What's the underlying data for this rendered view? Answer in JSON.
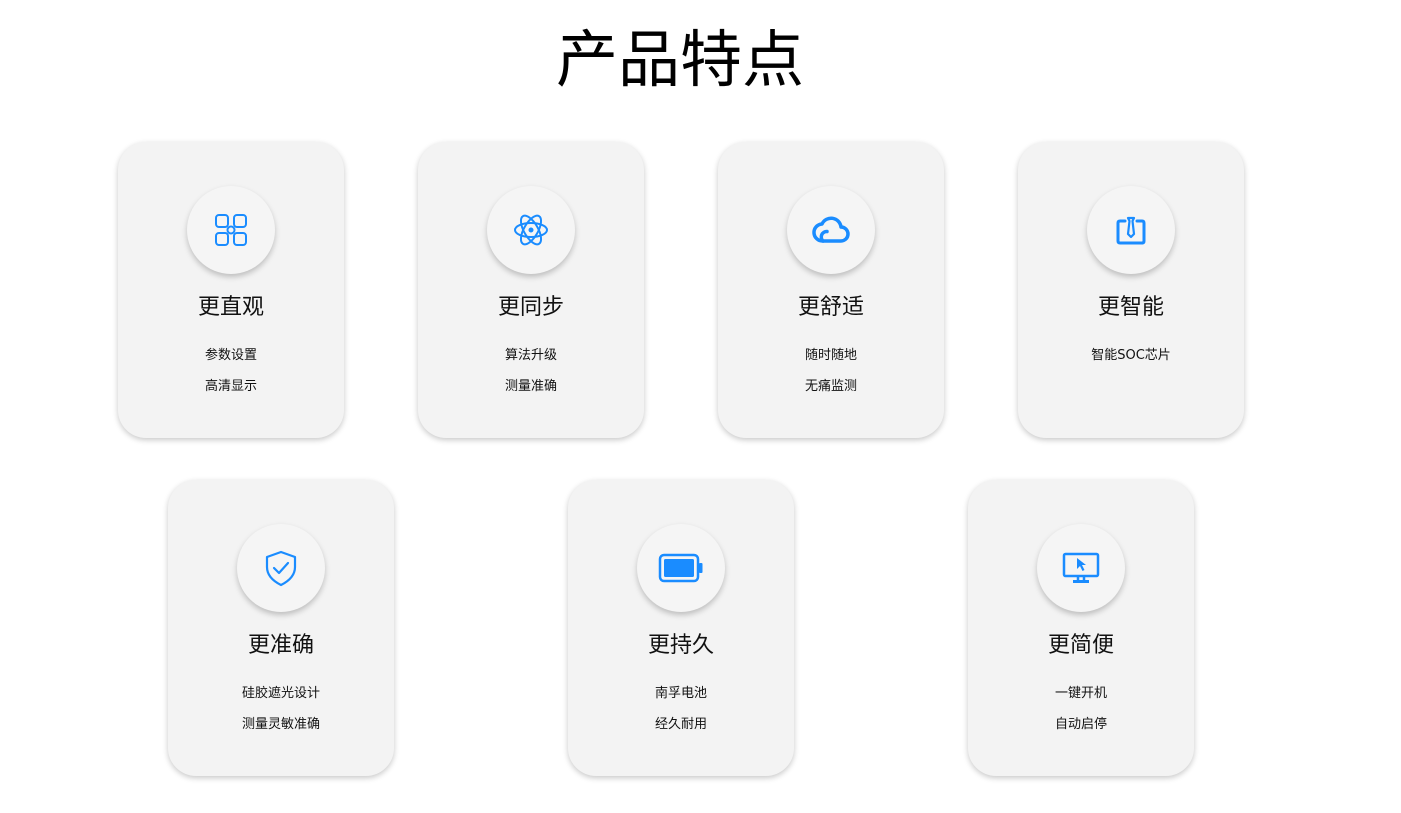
{
  "page": {
    "title": "产品特点"
  },
  "colors": {
    "icon_blue": "#1a8cff",
    "card_bg": "#f3f3f3"
  },
  "cards": [
    {
      "title": "更直观",
      "lines": [
        "参数设置",
        "高清显示"
      ],
      "icon": "grid-icon"
    },
    {
      "title": "更同步",
      "lines": [
        "算法升级",
        "测量准确"
      ],
      "icon": "atom-icon"
    },
    {
      "title": "更舒适",
      "lines": [
        "随时随地",
        "无痛监测"
      ],
      "icon": "cloud-icon"
    },
    {
      "title": "更智能",
      "lines": [
        "智能SOC芯片"
      ],
      "icon": "chip-icon"
    },
    {
      "title": "更准确",
      "lines": [
        "硅胶遮光设计",
        "测量灵敏准确"
      ],
      "icon": "shield-check-icon"
    },
    {
      "title": "更持久",
      "lines": [
        "南孚电池",
        "经久耐用"
      ],
      "icon": "battery-icon"
    },
    {
      "title": "更简便",
      "lines": [
        "一键开机",
        "自动启停"
      ],
      "icon": "monitor-cursor-icon"
    }
  ]
}
